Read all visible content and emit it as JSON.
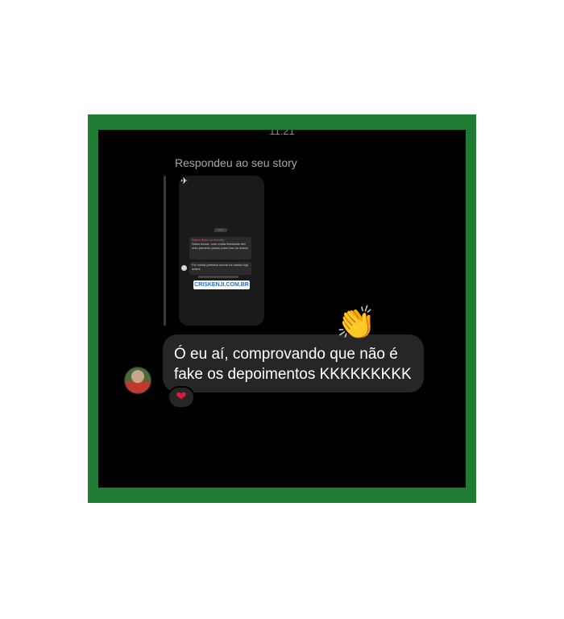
{
  "status_bar": {
    "time": "11:21"
  },
  "reply": {
    "label": "Respondeu ao seu story"
  },
  "story_preview": {
    "date_badge": "Hoje",
    "message1_sender": "Bruno Alves University",
    "message1_text": "Salve turma, com muita felicidade del meu primeiro passo para fora da matrix",
    "message1_time": "11:43",
    "message2_text": "Fiz minha primeira venda na minha loja online",
    "message2_time": "11:43",
    "url": "CRISKENJI.COM.BR",
    "icons": {
      "pin": "pin-icon"
    }
  },
  "message": {
    "text": "Ó eu aí, comprovando que não é fake os depoimentos KKKKKKKKK",
    "reaction": "❤",
    "reaction_color": "#e8163a"
  },
  "decorations": {
    "overlay_icon": "clapping-hands-icon",
    "frame_color": "#1f7a32"
  }
}
